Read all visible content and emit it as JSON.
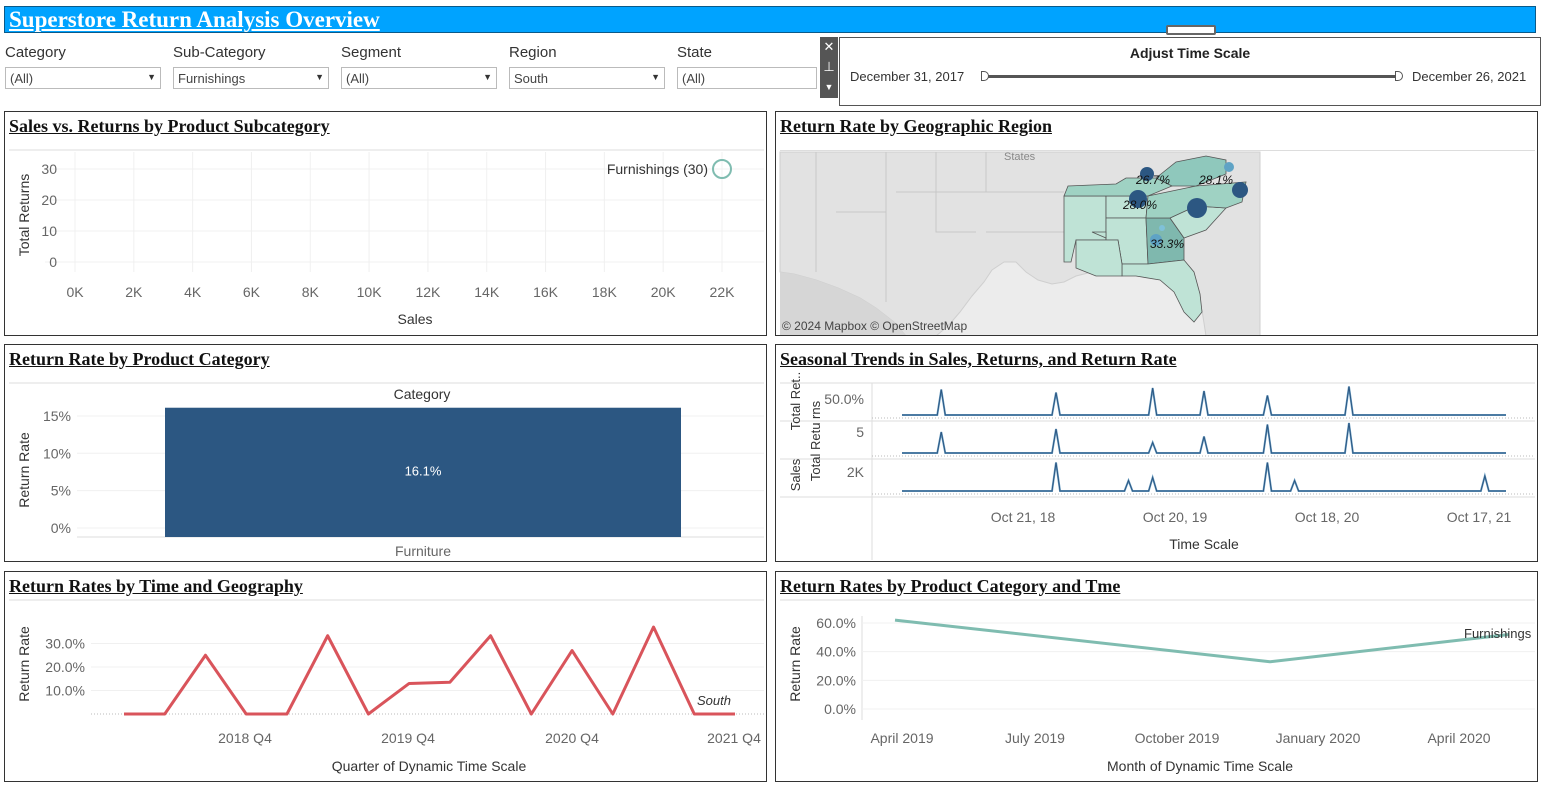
{
  "header": {
    "title": "Superstore Return Analysis Overview"
  },
  "filters": [
    {
      "label": "Category",
      "value": "(All)"
    },
    {
      "label": "Sub-Category",
      "value": "Furnishings"
    },
    {
      "label": "Segment",
      "value": "(All)"
    },
    {
      "label": "Region",
      "value": "South"
    },
    {
      "label": "State",
      "value": "(All)"
    }
  ],
  "time_filter": {
    "title": "Adjust Time Scale",
    "start": "December 31, 2017",
    "end": "December 26, 2021"
  },
  "colors": {
    "title_bar": "#00a3ff",
    "bar": "#2c5782",
    "line_red": "#d9545b",
    "line_teal": "#7fbcb0",
    "map_blue": "#2c5782"
  },
  "panels": {
    "sales_returns": {
      "title": "Sales vs. Returns by Product Subcategory"
    },
    "geo": {
      "title": "Return Rate by Geographic Region"
    },
    "category": {
      "title": "Return Rate by Product Category"
    },
    "seasonal": {
      "title": "Seasonal Trends in Sales, Returns, and Return Rate"
    },
    "time_geo": {
      "title": "Return Rates by Time and Geography"
    },
    "cat_time": {
      "title": "Return Rates by Product Category and Tme"
    }
  },
  "chart_data": [
    {
      "type": "scatter",
      "title": "Sales vs. Returns by Product Subcategory",
      "xlabel": "Sales",
      "ylabel": "Total Returns",
      "xticks": [
        "0K",
        "2K",
        "4K",
        "6K",
        "8K",
        "10K",
        "12K",
        "14K",
        "16K",
        "18K",
        "20K",
        "22K"
      ],
      "yticks": [
        "0",
        "10",
        "20",
        "30"
      ],
      "xlim": [
        0,
        22000
      ],
      "ylim": [
        0,
        30
      ],
      "points": [
        {
          "x": 22000,
          "y": 30,
          "label": "Furnishings (30)"
        }
      ]
    },
    {
      "type": "map",
      "title": "Return Rate by Geographic Region",
      "attribution": "© 2024 Mapbox © OpenStreetMap",
      "map_label": "States",
      "labels": [
        "26.7%",
        "28.1%",
        "28.0%",
        "33.3%"
      ]
    },
    {
      "type": "bar",
      "title": "Return Rate by Product Category",
      "header": "Category",
      "ylabel": "Return Rate",
      "categories": [
        "Furniture"
      ],
      "values": [
        16.1
      ],
      "value_labels": [
        "16.1%"
      ],
      "yticks": [
        "0%",
        "5%",
        "10%",
        "15%"
      ],
      "ylim": [
        0,
        17
      ]
    },
    {
      "type": "line",
      "title": "Seasonal Trends in Sales, Returns, and Return Rate",
      "xlabel": "Time Scale",
      "xticks": [
        "Oct 21, 18",
        "Oct 20, 19",
        "Oct 18, 20",
        "Oct 17, 21"
      ],
      "rows": [
        {
          "label": "Total Ret..",
          "tick": "50.0%",
          "peaks": [
            [
              0.065,
              0.85
            ],
            [
              0.255,
              0.75
            ],
            [
              0.415,
              0.9
            ],
            [
              0.5,
              0.8
            ],
            [
              0.605,
              0.65
            ],
            [
              0.74,
              0.95
            ]
          ]
        },
        {
          "label": "Total Retu rns",
          "tick": "5",
          "peaks": [
            [
              0.065,
              0.7
            ],
            [
              0.255,
              0.8
            ],
            [
              0.415,
              0.35
            ],
            [
              0.5,
              0.55
            ],
            [
              0.605,
              0.95
            ],
            [
              0.74,
              1.0
            ]
          ]
        },
        {
          "label": "Sales",
          "tick": "2K",
          "peaks": [
            [
              0.255,
              0.95
            ],
            [
              0.375,
              0.35
            ],
            [
              0.415,
              0.45
            ],
            [
              0.605,
              0.95
            ],
            [
              0.65,
              0.35
            ],
            [
              0.965,
              0.5
            ]
          ]
        }
      ]
    },
    {
      "type": "line",
      "title": "Return Rates by Time and Geography",
      "xlabel": "Quarter of Dynamic Time Scale",
      "ylabel": "Return Rate",
      "xticks": [
        "2018 Q4",
        "2019 Q4",
        "2020 Q4",
        "2021 Q4"
      ],
      "yticks": [
        "10.0%",
        "20.0%",
        "30.0%"
      ],
      "ylim": [
        0,
        40
      ],
      "series": [
        {
          "name": "South",
          "values": [
            0,
            0,
            25,
            0,
            0,
            33.3,
            0,
            13,
            13.5,
            33.3,
            0,
            27,
            0,
            37,
            0,
            0
          ]
        }
      ]
    },
    {
      "type": "line",
      "title": "Return Rates by Product Category and Tme",
      "xlabel": "Month of Dynamic Time Scale",
      "ylabel": "Return Rate",
      "xticks": [
        "April 2019",
        "July 2019",
        "October 2019",
        "January 2020",
        "April 2020"
      ],
      "yticks": [
        "0.0%",
        "20.0%",
        "40.0%",
        "60.0%"
      ],
      "ylim": [
        0,
        65
      ],
      "series": [
        {
          "name": "Furnishings",
          "x": [
            "April 2019",
            "December 2019",
            "April 2020"
          ],
          "values": [
            62,
            33,
            52
          ]
        }
      ]
    }
  ]
}
